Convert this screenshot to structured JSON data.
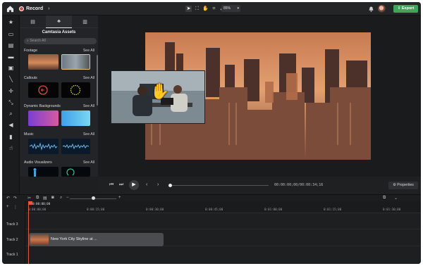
{
  "app": {
    "record_label": "Record",
    "zoom_value": "85%",
    "export_label": "Export"
  },
  "assets": {
    "title": "Camtasia Assets",
    "search_placeholder": "Search All",
    "sections": [
      {
        "name": "Footage",
        "see_all": "See All"
      },
      {
        "name": "Callouts",
        "see_all": "See All"
      },
      {
        "name": "Dynamic Backgrounds",
        "see_all": "See All"
      },
      {
        "name": "Music",
        "see_all": "See All"
      },
      {
        "name": "Audio Visualizers",
        "see_all": "See All"
      }
    ]
  },
  "player": {
    "timecode": "00:00:00;00/00:00:34;16",
    "properties_label": "Properties"
  },
  "timeline": {
    "playhead_label": "0:00:00;00",
    "ruler_ticks": [
      "0:00:00;00",
      "0:00:15;00",
      "0:00:30;00",
      "0:00:45;00",
      "0:01:00;00",
      "0:01:15;00",
      "0:01:30;00"
    ],
    "tracks": [
      {
        "label": "Track 3"
      },
      {
        "label": "Track 2"
      },
      {
        "label": "Track 1"
      }
    ],
    "clip_name": "New York City Skyline at ..."
  },
  "colors": {
    "accent_export": "#3fa55a",
    "playhead": "#e05a3d",
    "record_dot": "#e0493d"
  }
}
